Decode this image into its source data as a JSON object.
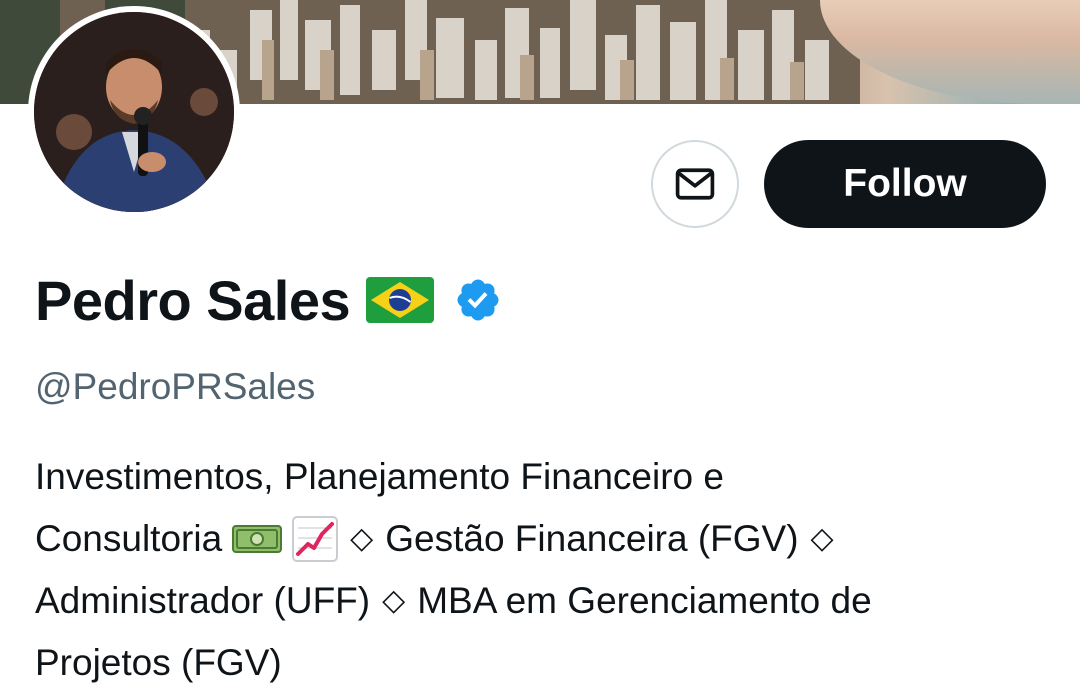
{
  "profile": {
    "display_name": "Pedro Sales",
    "handle": "@PedroPRSales",
    "flag_icon": "brazil-flag-icon",
    "verified_icon": "verified-badge-icon",
    "verified_color": "#1d9bf0"
  },
  "actions": {
    "message_icon": "mail-icon",
    "follow_label": "Follow"
  },
  "bio": {
    "line1": "Investimentos, Planejamento Financeiro e",
    "line2_a": "Consultoria",
    "line2_sep": "◇",
    "line2_b": "Gestão Financeira (FGV)",
    "line2_end": "◇",
    "line3_a": "Administrador (UFF)",
    "line3_sep": "◇",
    "line3_b": "MBA em Gerenciamento de",
    "line4": "Projetos (FGV)",
    "emoji_1": "money-icon",
    "emoji_2": "chart-increasing-icon"
  },
  "colors": {
    "text": "#0f1419",
    "secondary_text": "#536471",
    "follow_bg": "#0f1419",
    "border": "#cfd9de"
  }
}
